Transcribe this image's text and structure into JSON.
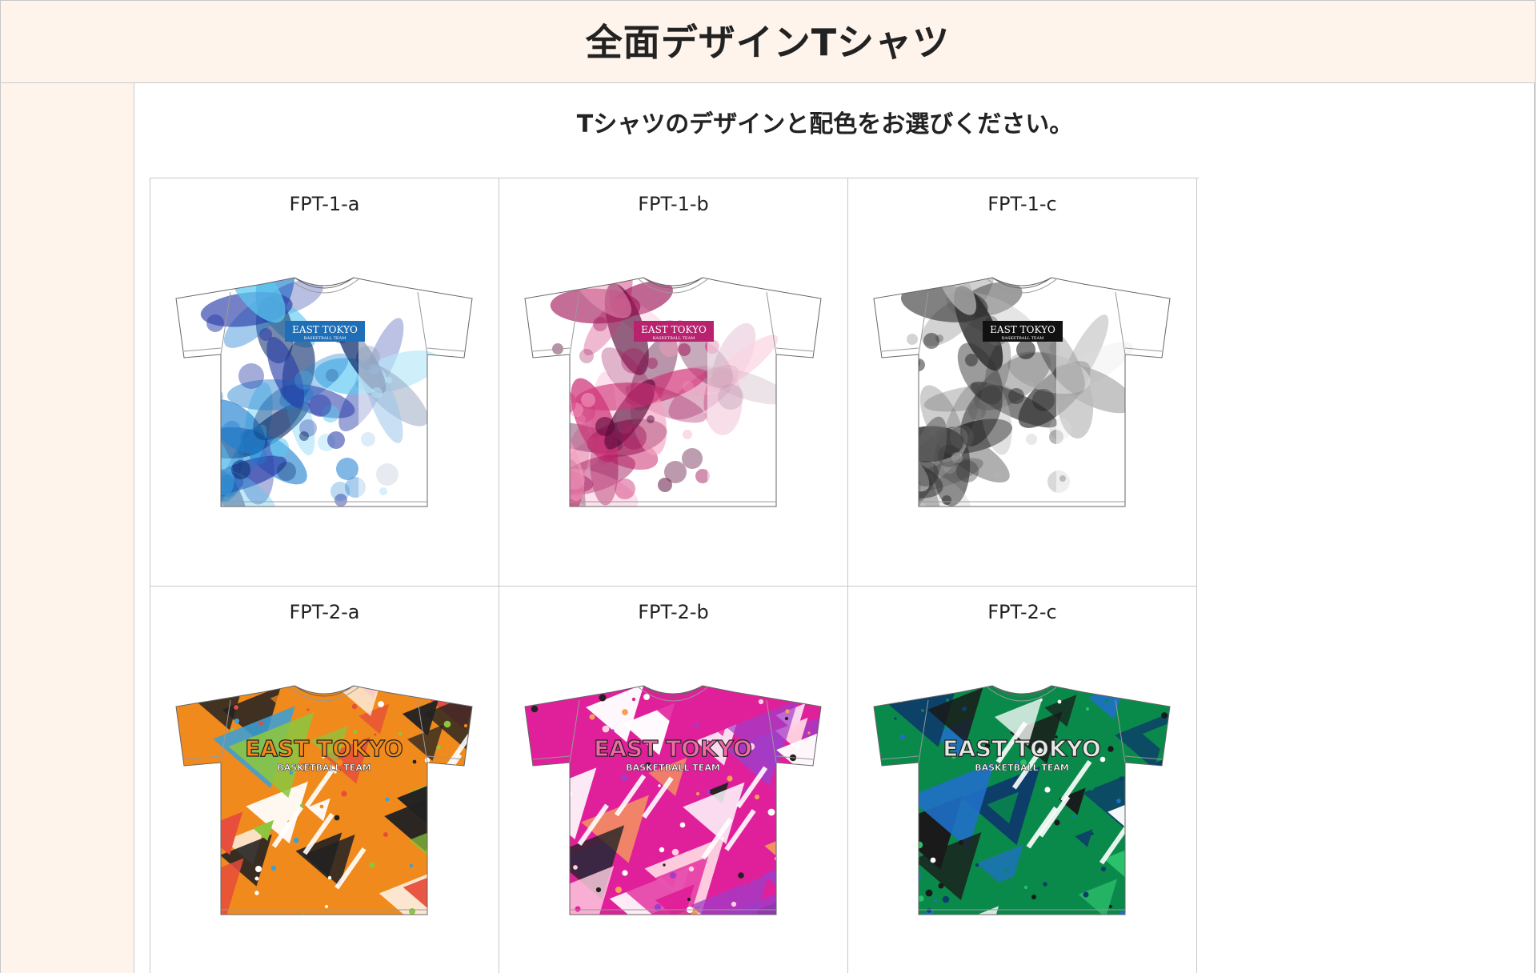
{
  "header": {
    "title": "全面デザインTシャツ"
  },
  "main": {
    "instruction": "Tシャツのデザインと配色をお選びください。",
    "designs": [
      {
        "code": "FPT-1-a",
        "pattern": "floral",
        "colors": [
          "#1e7fd0",
          "#2b3ea8",
          "#5cc8f0",
          "#0a2a6a"
        ],
        "logo_bg": "#1e6fb8",
        "logo_text": "EAST TOKYO",
        "logo_sub": "BASKETBALL TEAM"
      },
      {
        "code": "FPT-1-b",
        "pattern": "floral",
        "colors": [
          "#d0367a",
          "#a0175a",
          "#f5a0c0",
          "#5a0a3a"
        ],
        "logo_bg": "#b8226e",
        "logo_text": "EAST TOKYO",
        "logo_sub": "BASKETBALL TEAM"
      },
      {
        "code": "FPT-1-c",
        "pattern": "floral",
        "colors": [
          "#666666",
          "#333333",
          "#bbbbbb",
          "#111111"
        ],
        "logo_bg": "#111111",
        "logo_text": "EAST TOKYO",
        "logo_sub": "BASKETBALL TEAM"
      },
      {
        "code": "FPT-2-a",
        "pattern": "geometric",
        "colors": [
          "#f08a1c",
          "#8cc63f",
          "#3aa0d8",
          "#222222",
          "#ffffff",
          "#e74c3c"
        ],
        "logo_bg": "none",
        "logo_text": "EAST TOKYO",
        "logo_sub": "BASKETBALL TEAM"
      },
      {
        "code": "FPT-2-b",
        "pattern": "geometric",
        "colors": [
          "#e0209a",
          "#f5a05a",
          "#a03cc8",
          "#222222",
          "#ffffff",
          "#ffd0e0"
        ],
        "logo_bg": "none",
        "logo_text": "EAST TOKYO",
        "logo_sub": "BASKETBALL TEAM"
      },
      {
        "code": "FPT-2-c",
        "pattern": "geometric",
        "colors": [
          "#0a8a4a",
          "#1f6fc8",
          "#2cc06a",
          "#1a1a1a",
          "#ffffff",
          "#0d3d6a"
        ],
        "logo_bg": "none",
        "logo_text": "EAST TOKYO",
        "logo_sub": "BASKETBALL TEAM"
      }
    ]
  }
}
